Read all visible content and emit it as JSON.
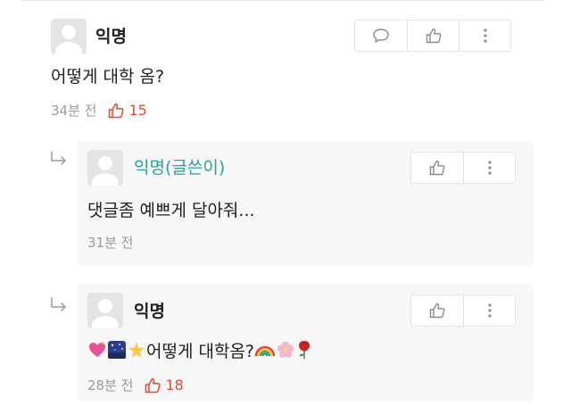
{
  "post": {
    "author": "익명",
    "text": "어떻게 대학 옴?",
    "time": "34분 전",
    "like_count": "15"
  },
  "replies": [
    {
      "author": "익명(글쓴이)",
      "text": "댓글좀 예쁘게 달아줘...",
      "time": "31분 전"
    },
    {
      "author": "익명",
      "text": "어떻게 대학옴?",
      "time": "28분 전",
      "like_count": "18"
    }
  ],
  "colors": {
    "writer_name": "#2e9e9b",
    "like_count": "#e0482f",
    "reply_background": "#f7f7f7"
  },
  "icons": [
    "comment-icon",
    "thumbs-up-icon",
    "more-vertical-icon",
    "reply-arrow-icon",
    "avatar-placeholder-icon"
  ],
  "emoji": {
    "before_text": [
      "sparkling-heart",
      "night-sky",
      "glowing-star"
    ],
    "after_text": [
      "rainbow",
      "cherry-blossom",
      "rose"
    ]
  }
}
